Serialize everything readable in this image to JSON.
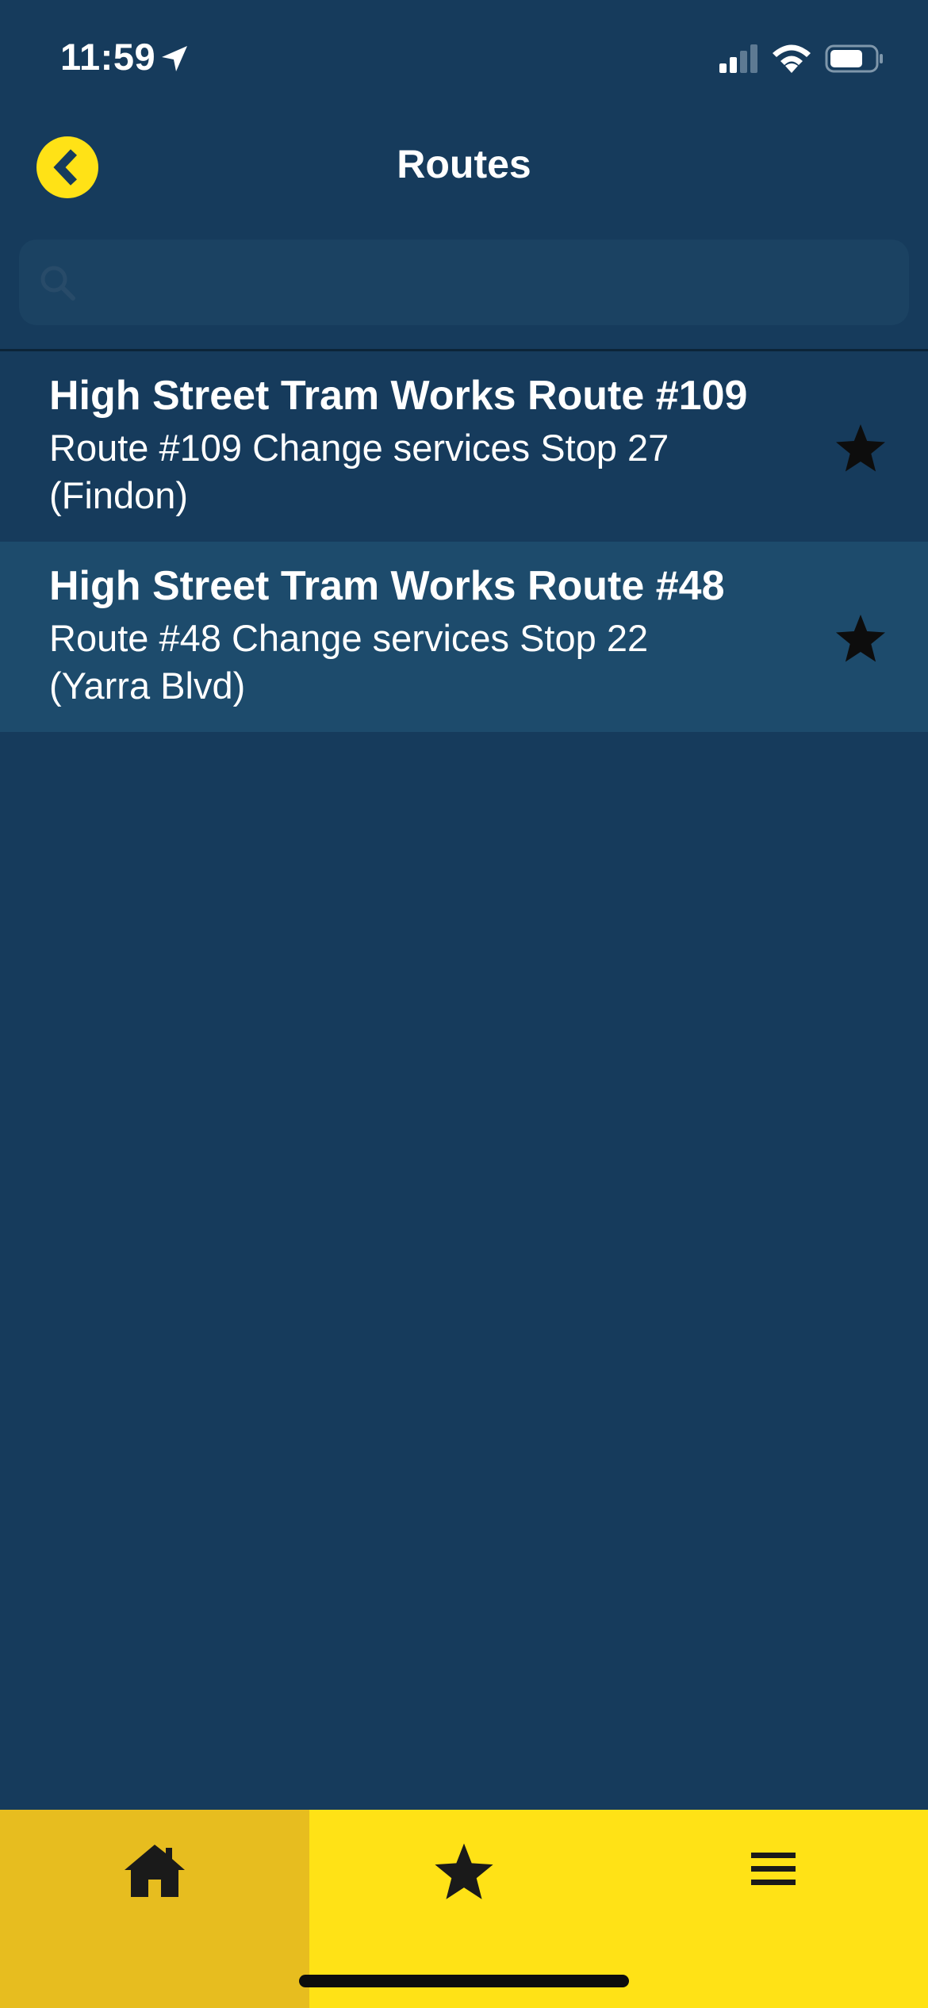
{
  "status_bar": {
    "time": "11:59"
  },
  "nav": {
    "title": "Routes"
  },
  "search": {
    "placeholder": "",
    "value": ""
  },
  "routes": [
    {
      "title": "High Street Tram Works Route #109",
      "description": "Route #109 Change services Stop 27 (Findon)",
      "favorite": true
    },
    {
      "title": "High Street Tram Works Route #48",
      "description": "Route #48 Change services Stop 22 (Yarra Blvd)",
      "favorite": true
    }
  ],
  "tab_bar": {
    "tabs": [
      {
        "icon": "home-icon",
        "active": true
      },
      {
        "icon": "star-icon",
        "active": false
      },
      {
        "icon": "menu-icon",
        "active": false
      }
    ]
  },
  "colors": {
    "background": "#163b5c",
    "accent_yellow": "#ffe216",
    "active_tab": "#e7bd1f",
    "highlight_row": "#1d4b6c"
  }
}
